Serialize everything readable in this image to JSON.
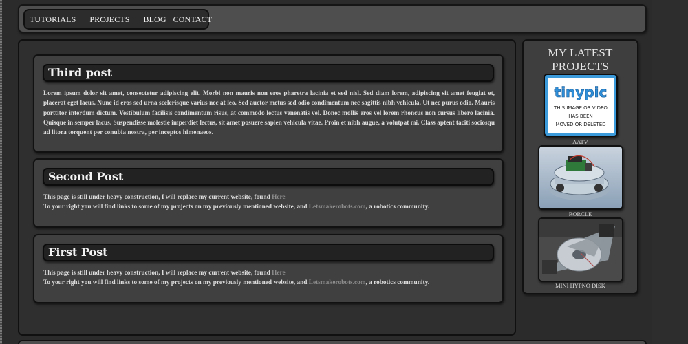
{
  "nav": {
    "items": [
      "TUTORIALS",
      "PROJECTS",
      "BLOG",
      "CONTACT"
    ]
  },
  "posts": [
    {
      "title": "Third post",
      "body": "Lorem ipsum dolor sit amet, consectetur adipiscing elit. Morbi non mauris non eros pharetra lacinia et sed nisl. Sed diam lorem, adipiscing sit amet feugiat et, placerat eget lacus. Nunc id eros sed urna scelerisque varius nec at leo. Sed auctor metus sed odio condimentum nec sagittis nibh vehicula. Ut nec purus odio. Mauris porttitor interdum dictum. Vestibulum facilisis condimentum risus, at commodo lectus venenatis vel. Donec mollis eros vel lorem rhoncus non cursus libero lacinia. Quisque in semper lacus. Suspendisse molestie imperdiet lectus, sit amet posuere sapien vehicula vitae. Proin et nibh augue, a volutpat mi. Class aptent taciti sociosqu ad litora torquent per conubia nostra, per inceptos himenaeos."
    },
    {
      "title": "Second Post",
      "line1": "This page is still under heavy construction, I will replace my current website, found",
      "link1": "Here",
      "line2_pre": "To your right you will find links to some of my projects on my previously mentioned website, and",
      "link2": "Letsmakerobots.com",
      "line2_post": ", a robotics community."
    },
    {
      "title": "First Post",
      "line1": "This page is still under heavy construction, I will replace my current website, found",
      "link1": "Here",
      "line2_pre": "To your right you will find links to some of my projects on my previously mentioned website, and",
      "link2": "Letsmakerobots.com",
      "line2_post": ", a robotics community."
    }
  ],
  "sidebar": {
    "title_line1": "MY LATEST",
    "title_line2": "PROJECTS",
    "projects": [
      {
        "caption": "AATV",
        "placeholder_logo": "tinypic",
        "placeholder_line1": "THIS IMAGE OR VIDEO",
        "placeholder_line2": "HAS BEEN",
        "placeholder_line3": "MOVED OR DELETED"
      },
      {
        "caption": "RORCLE"
      },
      {
        "caption": "MINI HYPNO DISK"
      }
    ]
  },
  "colors": {
    "background": "#2b2b2b",
    "panel": "#404040",
    "title_bar": "#222222",
    "link": "#8c8c8c",
    "tinypic_blue": "#3fa9e6"
  }
}
